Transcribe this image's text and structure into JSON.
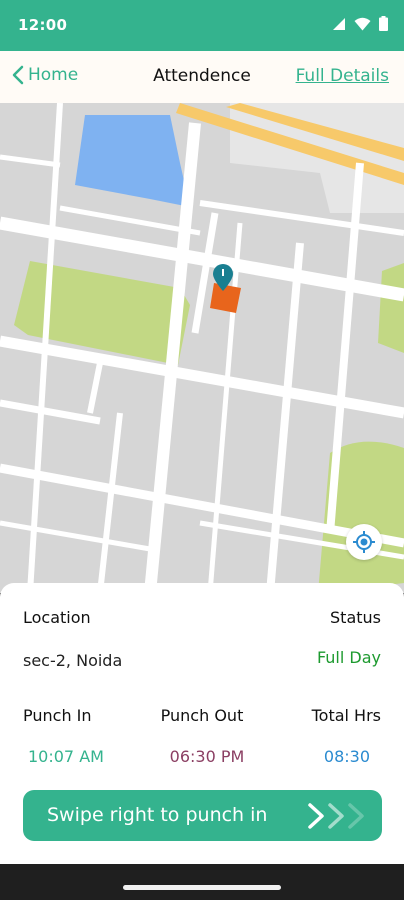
{
  "status_bar": {
    "time": "12:00"
  },
  "header": {
    "back_label": "Home",
    "title": "Attendence",
    "details_link": "Full Details"
  },
  "info": {
    "location_label": "Location",
    "status_label": "Status",
    "location_value": "sec-2, Noida",
    "status_value": "Full Day",
    "punch_in_label": "Punch In",
    "punch_out_label": "Punch Out",
    "total_hrs_label": "Total Hrs",
    "punch_in_time": "10:07 AM",
    "punch_out_time": "06:30 PM",
    "total_hrs": "08:30"
  },
  "colors": {
    "brand": "#34b38e",
    "status_full_day": "#1d9a2f",
    "punch_in": "#34b38e",
    "punch_out": "#8b3f63",
    "total_hrs": "#2b8bd0",
    "map_marker": "#e8651c",
    "map_pin": "#1a7f91"
  },
  "icons": {
    "back": "chevron-left-icon",
    "locate": "my-location-icon",
    "swipe": "triple-chevron-right-icon",
    "signal": "signal-icon",
    "wifi": "wifi-icon",
    "battery": "battery-icon"
  },
  "swipe": {
    "label": "Swipe right to punch in"
  }
}
